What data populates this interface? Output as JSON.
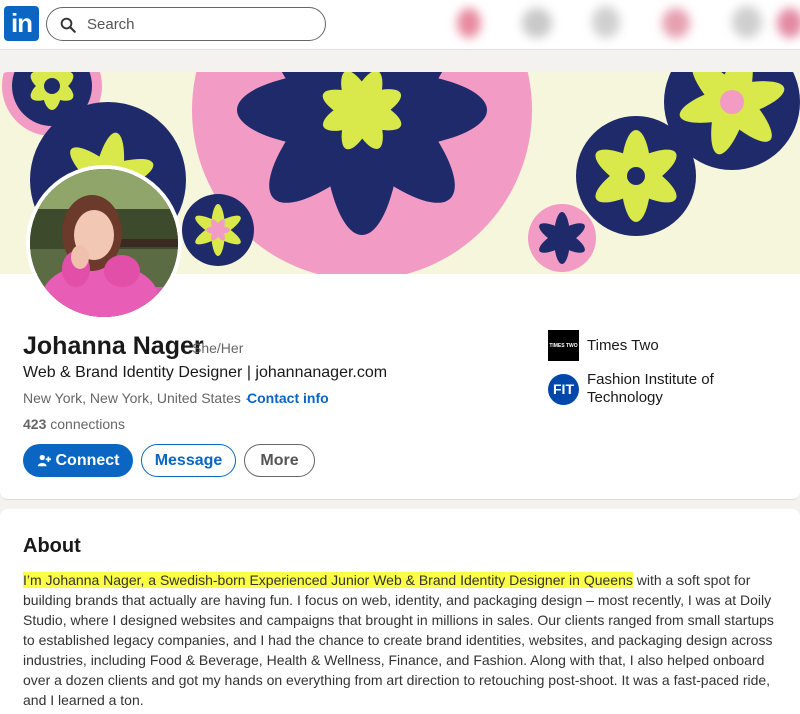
{
  "nav": {
    "logo_text": "in",
    "search_placeholder": "Search"
  },
  "profile": {
    "name": "Johanna Nager",
    "pronouns": "She/Her",
    "headline": "Web & Brand Identity Designer | johannanager.com",
    "location": "New York, New York, United States · ",
    "contact_label": "Contact info",
    "connections_count": "423",
    "connections_label": " connections",
    "buttons": {
      "connect": "Connect",
      "message": "Message",
      "more": "More"
    },
    "orgs": [
      {
        "logo_text": "TIMES TWO",
        "name": "Times Two"
      },
      {
        "logo_text": "FIT",
        "name": "Fashion Institute of Technology"
      }
    ]
  },
  "about": {
    "title": "About",
    "highlighted": "I’m Johanna Nager, a Swedish-born Experienced Junior Web & Brand Identity Designer in Queens",
    "rest": " with a soft spot for building brands that actually are having fun. I focus on web, identity, and packaging design – most recently, I was at Doily Studio, where I designed websites and campaigns that brought in millions in sales. Our clients ranged from small startups to established legacy companies, and I had the chance to create brand identities, websites, and packaging design across industries, including Food & Beverage, Health & Wellness, Finance, and Fashion. Along with that, I also helped onboard over a dozen clients and got my hands on everything from art direction to retouching post-shoot. It was a fast-paced ride, and I learned a ton."
  },
  "colors": {
    "brand_blue": "#0a66c2",
    "highlight": "#fbff45",
    "banner_pink": "#f29bc4",
    "banner_navy": "#1f2a6b",
    "banner_lime": "#d9e84a"
  }
}
